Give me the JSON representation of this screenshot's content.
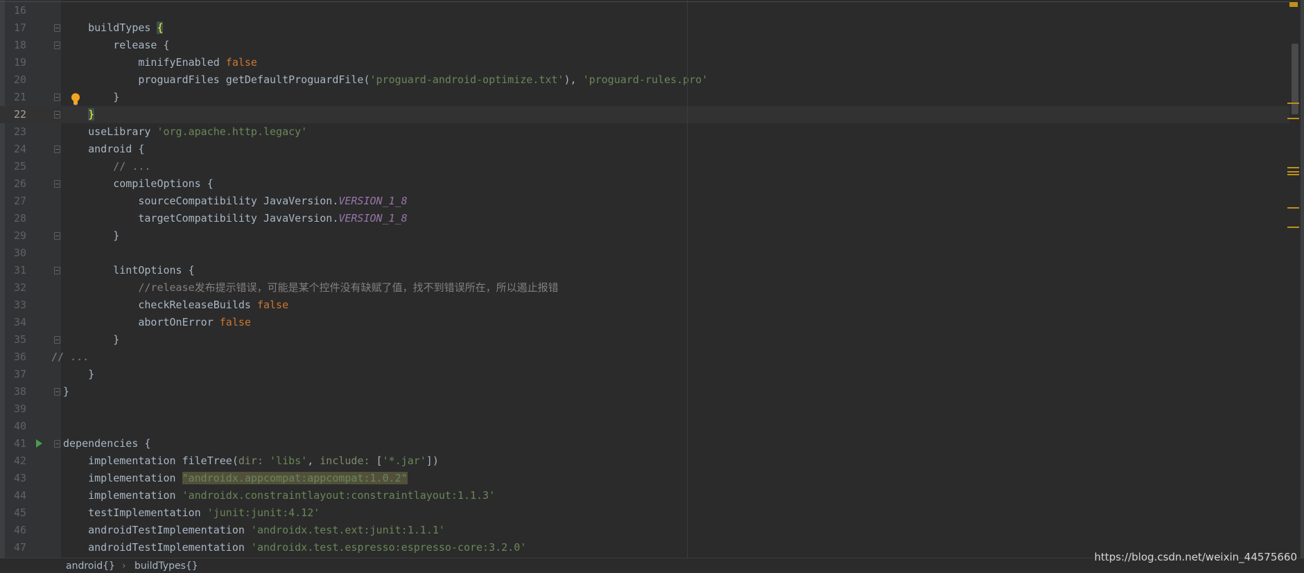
{
  "editor": {
    "current_line": 22,
    "lines": [
      {
        "n": 16,
        "i": 0,
        "fold": false,
        "t": []
      },
      {
        "n": 17,
        "i": 1,
        "fold": true,
        "t": [
          [
            "",
            "buildTypes "
          ],
          [
            "brace",
            "{"
          ]
        ]
      },
      {
        "n": 18,
        "i": 2,
        "fold": true,
        "t": [
          [
            "",
            "release {"
          ]
        ]
      },
      {
        "n": 19,
        "i": 3,
        "fold": false,
        "t": [
          [
            "",
            "minifyEnabled "
          ],
          [
            "kw",
            "false"
          ]
        ]
      },
      {
        "n": 20,
        "i": 3,
        "fold": false,
        "t": [
          [
            "",
            "proguardFiles getDefaultProguardFile("
          ],
          [
            "str",
            "'proguard-android-optimize.txt'"
          ],
          [
            "",
            "), "
          ],
          [
            "str",
            "'proguard-rules.pro'"
          ]
        ]
      },
      {
        "n": 21,
        "i": 2,
        "fold": true,
        "t": [
          [
            "",
            "}"
          ]
        ]
      },
      {
        "n": 22,
        "i": 1,
        "fold": true,
        "t": [
          [
            "brace",
            "}"
          ]
        ]
      },
      {
        "n": 23,
        "i": 1,
        "fold": false,
        "t": [
          [
            "",
            "useLibrary "
          ],
          [
            "str",
            "'org.apache.http.legacy'"
          ]
        ]
      },
      {
        "n": 24,
        "i": 1,
        "fold": true,
        "t": [
          [
            "",
            "android {"
          ]
        ]
      },
      {
        "n": 25,
        "i": 2,
        "fold": false,
        "t": [
          [
            "cmt",
            "// ..."
          ]
        ]
      },
      {
        "n": 26,
        "i": 2,
        "fold": true,
        "t": [
          [
            "",
            "compileOptions {"
          ]
        ]
      },
      {
        "n": 27,
        "i": 3,
        "fold": false,
        "t": [
          [
            "",
            "sourceCompatibility JavaVersion."
          ],
          [
            "const",
            "VERSION_1_8"
          ]
        ]
      },
      {
        "n": 28,
        "i": 3,
        "fold": false,
        "t": [
          [
            "",
            "targetCompatibility JavaVersion."
          ],
          [
            "const",
            "VERSION_1_8"
          ]
        ]
      },
      {
        "n": 29,
        "i": 2,
        "fold": true,
        "t": [
          [
            "",
            "}"
          ]
        ]
      },
      {
        "n": 30,
        "i": 0,
        "fold": false,
        "t": []
      },
      {
        "n": 31,
        "i": 2,
        "fold": true,
        "t": [
          [
            "",
            "lintOptions {"
          ]
        ]
      },
      {
        "n": 32,
        "i": 3,
        "fold": false,
        "t": [
          [
            "cmt",
            "//release发布提示错误，可能是某个控件没有缺赋了值，找不到错误所在，所以遏止报错"
          ]
        ]
      },
      {
        "n": 33,
        "i": 3,
        "fold": false,
        "t": [
          [
            "",
            "checkReleaseBuilds "
          ],
          [
            "kw",
            "false"
          ]
        ]
      },
      {
        "n": 34,
        "i": 3,
        "fold": false,
        "t": [
          [
            "",
            "abortOnError "
          ],
          [
            "kw",
            "false"
          ]
        ]
      },
      {
        "n": 35,
        "i": 2,
        "fold": true,
        "t": [
          [
            "",
            "}"
          ]
        ]
      },
      {
        "n": 36,
        "i": -1,
        "fold": false,
        "t": [
          [
            "cmt",
            "// ..."
          ]
        ]
      },
      {
        "n": 37,
        "i": 1,
        "fold": false,
        "t": [
          [
            "",
            "}"
          ]
        ]
      },
      {
        "n": 38,
        "i": 0,
        "fold": true,
        "t": [
          [
            "",
            "}"
          ]
        ]
      },
      {
        "n": 39,
        "i": 0,
        "fold": false,
        "t": []
      },
      {
        "n": 40,
        "i": 0,
        "fold": false,
        "t": []
      },
      {
        "n": 41,
        "i": 0,
        "fold": true,
        "run": true,
        "t": [
          [
            "",
            "dependencies {"
          ]
        ]
      },
      {
        "n": 42,
        "i": 1,
        "fold": false,
        "t": [
          [
            "",
            "implementation fileTree("
          ],
          [
            "arg",
            "dir: "
          ],
          [
            "str",
            "'libs'"
          ],
          [
            "",
            ", "
          ],
          [
            "arg",
            "include: "
          ],
          [
            "",
            "["
          ],
          [
            "str",
            "'*.jar'"
          ],
          [
            "",
            "])"
          ]
        ]
      },
      {
        "n": 43,
        "i": 1,
        "fold": false,
        "t": [
          [
            "",
            "implementation "
          ],
          [
            "str hl",
            "\"androidx.appcompat:appcompat:1.0.2\""
          ]
        ]
      },
      {
        "n": 44,
        "i": 1,
        "fold": false,
        "t": [
          [
            "",
            "implementation "
          ],
          [
            "str",
            "'androidx.constraintlayout:constraintlayout:1.1.3'"
          ]
        ]
      },
      {
        "n": 45,
        "i": 1,
        "fold": false,
        "t": [
          [
            "",
            "testImplementation "
          ],
          [
            "str",
            "'junit:junit:4.12'"
          ]
        ]
      },
      {
        "n": 46,
        "i": 1,
        "fold": false,
        "t": [
          [
            "",
            "androidTestImplementation "
          ],
          [
            "str",
            "'androidx.test.ext:junit:1.1.1'"
          ]
        ]
      },
      {
        "n": 47,
        "i": 1,
        "fold": false,
        "t": [
          [
            "",
            "androidTestImplementation "
          ],
          [
            "str",
            "'androidx.test.espresso:espresso-core:3.2.0'"
          ]
        ]
      }
    ]
  },
  "breadcrumb": {
    "items": [
      "android{}",
      "buildTypes{}"
    ],
    "separator": "›"
  },
  "watermark": "https://blog.csdn.net/weixin_44575660",
  "icons": {
    "gutter_bulb": "lightbulb-icon",
    "gutter_run": "run-arrow-icon"
  },
  "colors": {
    "background": "#2b2b2b",
    "keyword": "#cc7832",
    "string": "#6a8759",
    "constant": "#9876aa",
    "comment": "#808080",
    "warning_marker": "#be9117"
  }
}
